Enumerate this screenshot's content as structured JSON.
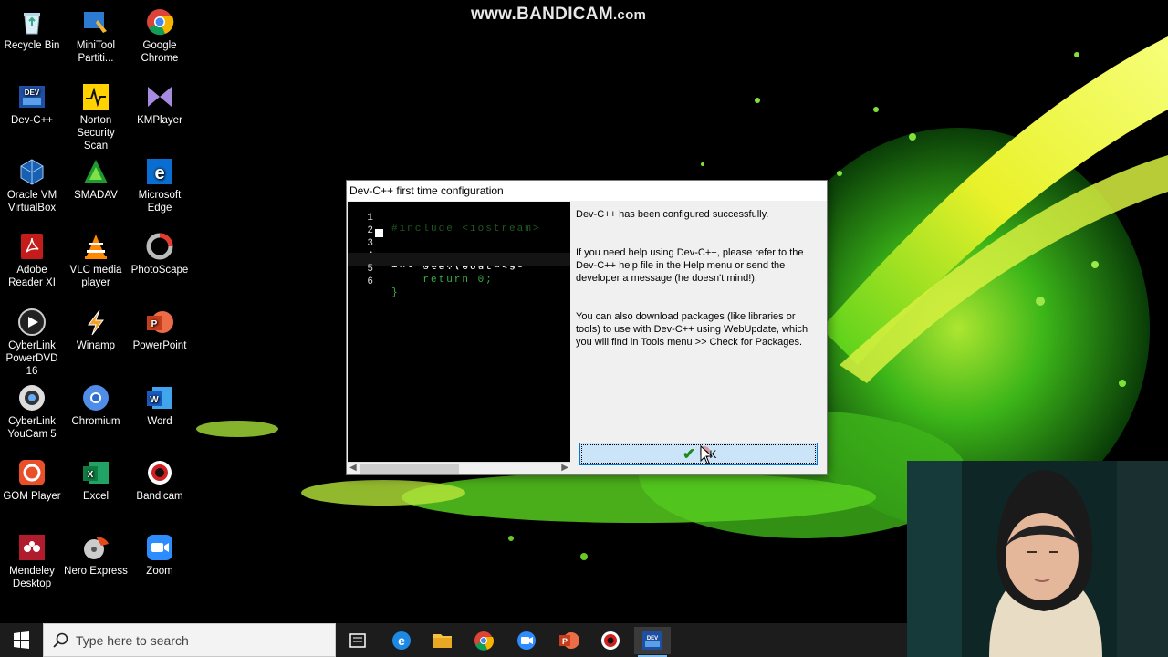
{
  "watermark": {
    "main": "www.BANDICAM",
    "suffix": ".com"
  },
  "desktop_icons": [
    {
      "id": "recycle-bin",
      "label": "Recycle Bin"
    },
    {
      "id": "minitool",
      "label": "MiniTool Partiti..."
    },
    {
      "id": "google-chrome",
      "label": "Google Chrome"
    },
    {
      "id": "devcpp",
      "label": "Dev-C++"
    },
    {
      "id": "norton",
      "label": "Norton Security Scan"
    },
    {
      "id": "kmplayer",
      "label": "KMPlayer"
    },
    {
      "id": "virtualbox",
      "label": "Oracle VM VirtualBox"
    },
    {
      "id": "smadav",
      "label": "SMADAV"
    },
    {
      "id": "edge",
      "label": "Microsoft Edge"
    },
    {
      "id": "adobe-reader",
      "label": "Adobe Reader XI"
    },
    {
      "id": "vlc",
      "label": "VLC media player"
    },
    {
      "id": "photoscape",
      "label": "PhotoScape"
    },
    {
      "id": "powerdvd",
      "label": "CyberLink PowerDVD 16"
    },
    {
      "id": "winamp",
      "label": "Winamp"
    },
    {
      "id": "powerpoint",
      "label": "PowerPoint"
    },
    {
      "id": "youcam",
      "label": "CyberLink YouCam 5"
    },
    {
      "id": "chromium",
      "label": "Chromium"
    },
    {
      "id": "word",
      "label": "Word"
    },
    {
      "id": "gom-player",
      "label": "GOM Player"
    },
    {
      "id": "excel",
      "label": "Excel"
    },
    {
      "id": "bandicam",
      "label": "Bandicam"
    },
    {
      "id": "mendeley",
      "label": "Mendeley Desktop"
    },
    {
      "id": "nero",
      "label": "Nero Express"
    },
    {
      "id": "zoom",
      "label": "Zoom"
    }
  ],
  "dialog": {
    "title": "Dev-C++ first time configuration",
    "code_lines": [
      {
        "num": "1",
        "text": "#include <iostream>",
        "color": "#1a4d1a"
      },
      {
        "num": "2",
        "text": "",
        "color": "#ffffff"
      },
      {
        "num": "3",
        "text": "int main(int argc",
        "color": "#ffffff"
      },
      {
        "num": "4",
        "text": "    std::cout << ",
        "color": "#ffffff"
      },
      {
        "num": "5",
        "text": "    return 0;",
        "color": "#3cb043"
      },
      {
        "num": "6",
        "text": "}",
        "color": "#3cb043"
      }
    ],
    "paragraphs": [
      "Dev-C++ has been configured successfully.",
      "If you need help using Dev-C++, please refer to the Dev-C++ help file in the Help menu or send the developer a message (he doesn't mind!).",
      "You can also download packages (like libraries or tools) to use with Dev-C++ using WebUpdate, which you will find in Tools menu >> Check for Packages."
    ],
    "ok_label": "OK"
  },
  "taskbar": {
    "search_placeholder": "Type here to search",
    "pinned": [
      "task-view",
      "edge",
      "file-explorer",
      "chrome",
      "zoom",
      "powerpoint",
      "bandicam",
      "devcpp"
    ],
    "active_app": "devcpp"
  },
  "colors": {
    "accent": "#0078d7",
    "button_bg": "#cce4f7",
    "taskbar": "#1c1c1c"
  }
}
